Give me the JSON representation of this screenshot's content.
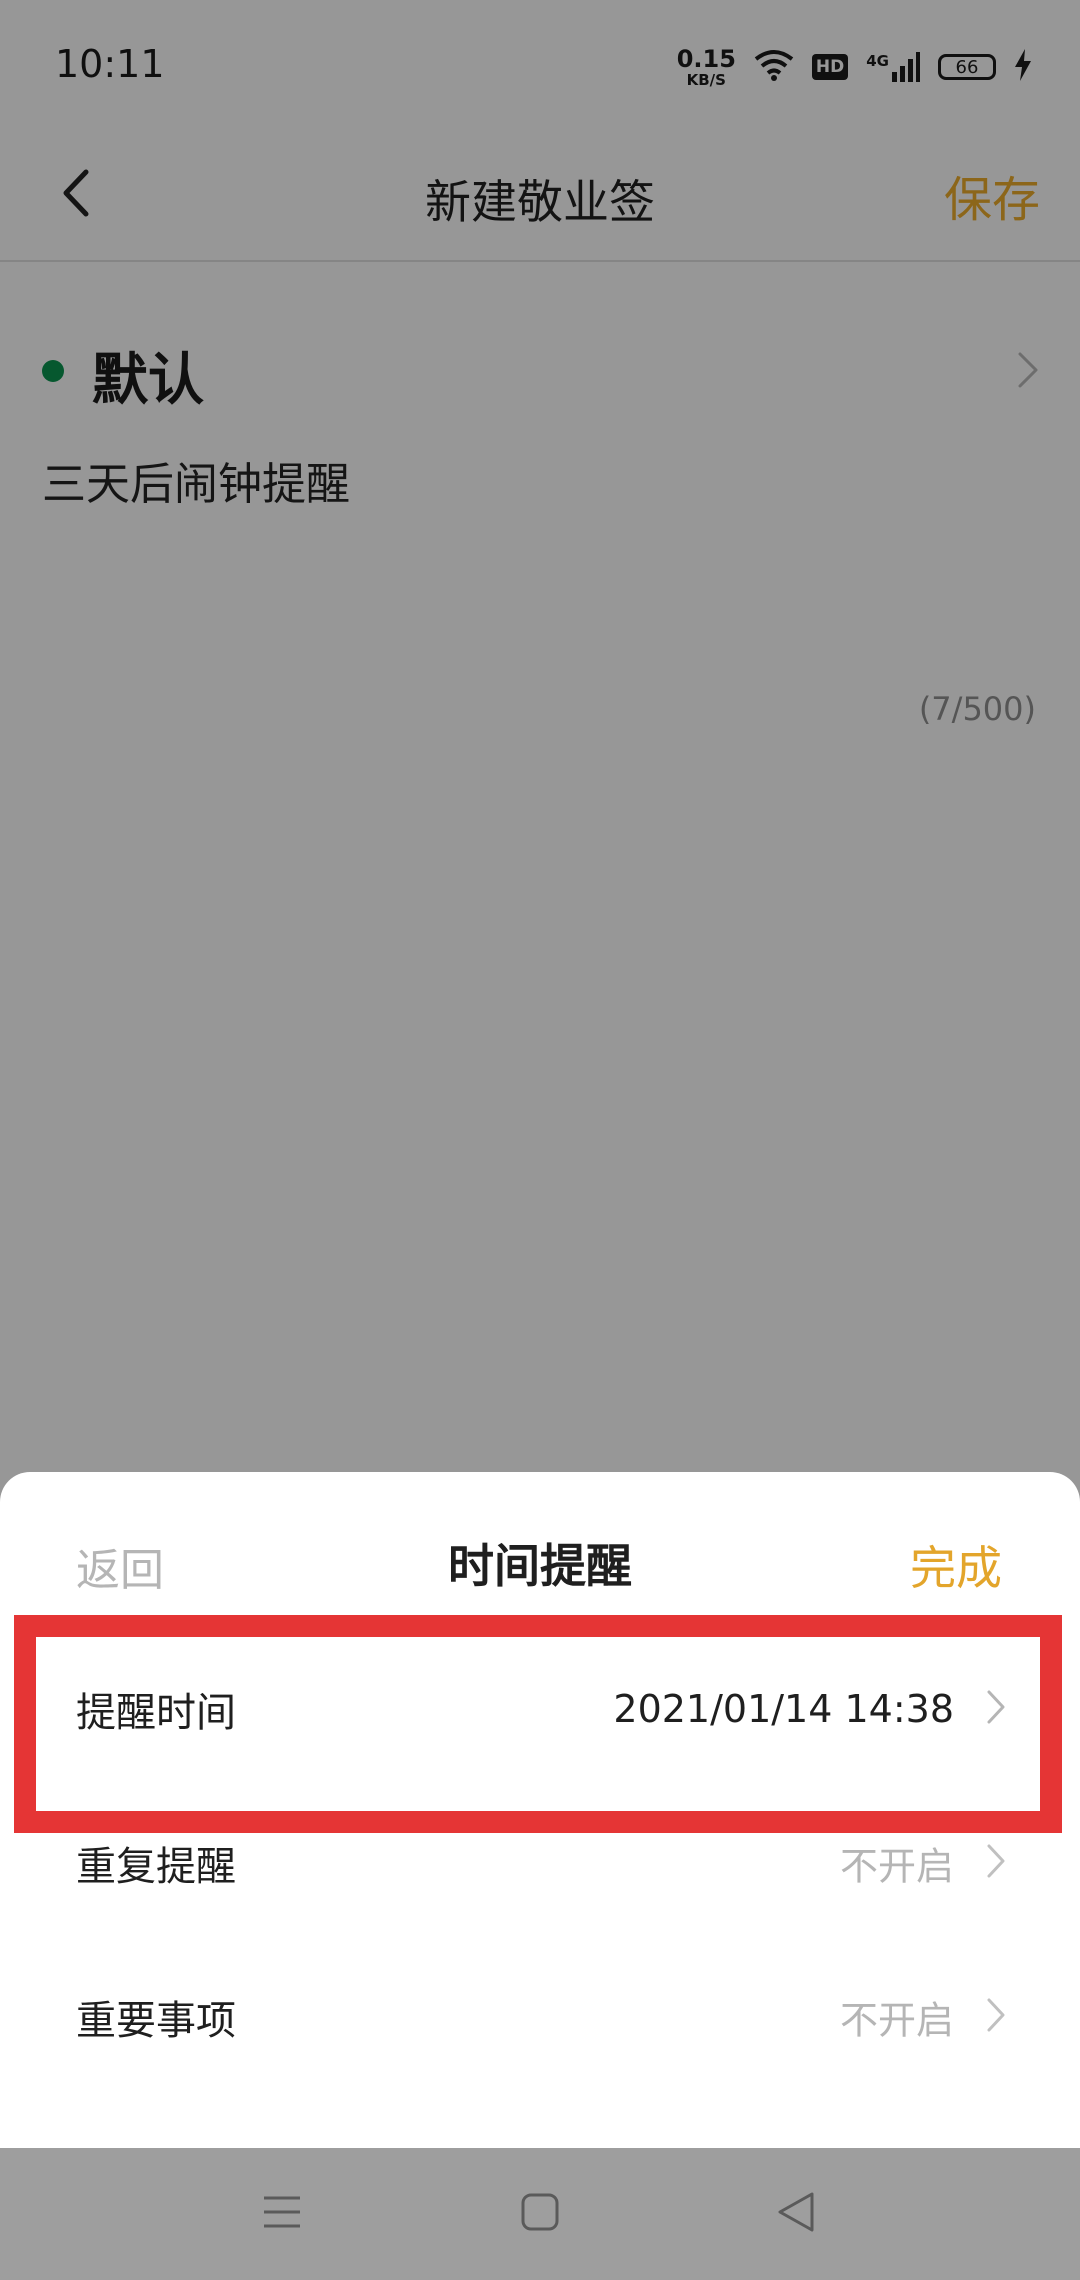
{
  "status_bar": {
    "time": "10:11",
    "net_speed_value": "0.15",
    "net_speed_unit": "KB/S",
    "hd": "HD",
    "network": "4G",
    "battery": "66"
  },
  "header": {
    "title": "新建敬业签",
    "save_label": "保存"
  },
  "note": {
    "category": "默认",
    "body": "三天后闹钟提醒",
    "char_count": "(7/500)"
  },
  "sheet": {
    "back_label": "返回",
    "title": "时间提醒",
    "done_label": "完成",
    "rows": [
      {
        "label": "提醒时间",
        "value": "2021/01/14 14:38"
      },
      {
        "label": "重复提醒",
        "value": "不开启"
      },
      {
        "label": "重要事项",
        "value": "不开启"
      }
    ]
  },
  "colors": {
    "accent": "#e3a52b",
    "category_dot": "#0a8f4c",
    "highlight": "#e53535"
  }
}
